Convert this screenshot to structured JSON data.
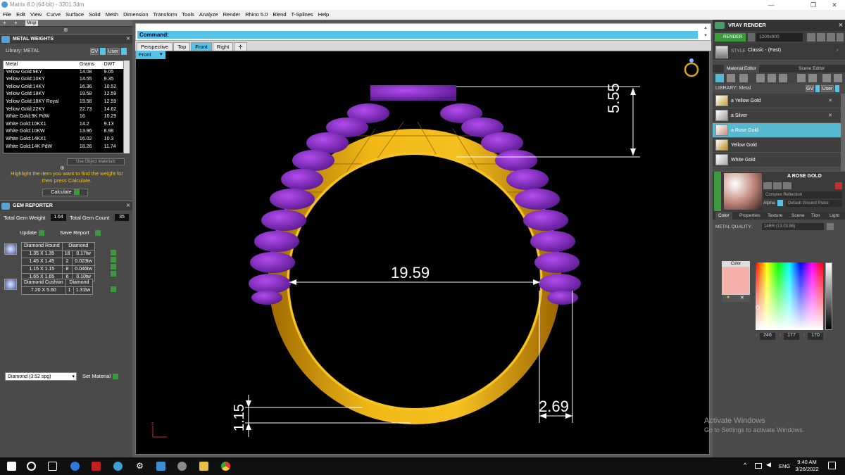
{
  "window": {
    "title": "Matrix 8.0 (64-bit) - 3201.3dm",
    "minimize": "—",
    "maximize": "❐",
    "close": "✕"
  },
  "menu": [
    "File",
    "Edit",
    "View",
    "Curve",
    "Surface",
    "Solid",
    "Mesh",
    "Dimension",
    "Transform",
    "Tools",
    "Analyze",
    "Render",
    "Rhino 5.0",
    "Blend",
    "T-Splines",
    "Help"
  ],
  "left_toolstrip": {
    "mngr": "Mngr"
  },
  "metal_weights": {
    "title": "METAL WEIGHTS",
    "library_label": "Library: METAL",
    "library_gv": "GV",
    "library_user": "User",
    "columns": [
      "Metal",
      "Grams",
      "DWT"
    ],
    "rows": [
      [
        "Yellow Gold:9KY",
        "14.08",
        "9.05"
      ],
      [
        "Yellow Gold:10KY",
        "14.55",
        "9.35"
      ],
      [
        "Yellow Gold:14KY",
        "16.36",
        "10.52"
      ],
      [
        "Yellow Gold:18KY",
        "19.58",
        "12.59"
      ],
      [
        "Yellow Gold:18KY Royal",
        "19.58",
        "12.59"
      ],
      [
        "Yellow Gold:22KY",
        "22.73",
        "14.62"
      ],
      [
        "White Gold:9K PdW",
        "16",
        "10.29"
      ],
      [
        "White Gold:10KX1",
        "14.2",
        "9.13"
      ],
      [
        "White Gold:10KW",
        "13.96",
        "8.98"
      ],
      [
        "White Gold:14KX1",
        "16.02",
        "10.3"
      ],
      [
        "White Gold:14K PdW",
        "18.26",
        "11.74"
      ]
    ],
    "use_object_materials": "Use Object Materials",
    "hint": "Highlight the item you want to find the weight for then press Calculate.",
    "calculate": "Calculate"
  },
  "gem_reporter": {
    "title": "GEM REPORTER",
    "total_weight_label": "Total Gem Weight",
    "total_weight": "1.64",
    "total_count_label": "Total Gem Count",
    "total_count": "35",
    "update": "Update",
    "save_report": "Save Report",
    "groups": [
      {
        "shape": "Diamond Round",
        "material": "Diamond",
        "rows": [
          [
            "1.35 X 1.35",
            "18",
            "0.17tw"
          ],
          [
            "1.45 X 1.45",
            "2",
            "0.023tw"
          ],
          [
            "1.15 X 1.15",
            "8",
            "0.046tw"
          ],
          [
            "1.65 X 1.65",
            "6",
            "0.10tw"
          ]
        ]
      },
      {
        "shape": "Diamond Cushion",
        "material": "Diamond",
        "rows": [
          [
            "7.20 X 5.60",
            "1",
            "1.31tw"
          ]
        ]
      }
    ],
    "material_select": "Diamond    (3.52 spg)",
    "set_material": "Set Material"
  },
  "command": {
    "label": "Command:"
  },
  "viewport_tabs": [
    "Perspective",
    "Top",
    "Front",
    "Right"
  ],
  "active_tab": "Front",
  "add_tab": "✛",
  "viewport_label": "Front",
  "dimensions": {
    "height": "5.55",
    "inner_diameter": "19.59",
    "shank_width": "2.69",
    "thickness": "1.15"
  },
  "axis": {
    "z": "z"
  },
  "vray": {
    "title": "VRAY RENDER",
    "render": "RENDER",
    "resolution": "1200x900",
    "style_label": "STYLE",
    "style": "Classic - (Fast)",
    "tabs": [
      "Material Editor",
      "Scene Editor"
    ],
    "library_label": "LIBRARY: Metal",
    "library_gv": "GV",
    "library_user": "User",
    "materials": [
      "a Yellow Gold",
      "a Silver",
      "a Rose Gold",
      "Yellow Gold",
      "White Gold"
    ],
    "selected_material": "a Rose Gold",
    "preview_title": "A ROSE GOLD",
    "complex_reflection": "Complex Reflection",
    "alpha": "Alpha",
    "ground_plane": "Default Ground Plane",
    "bottom_tabs": [
      "Color",
      "Properties",
      "Texture",
      "Scene",
      "Tion",
      "Light"
    ],
    "metal_quality_label": "METAL QUALITY:",
    "metal_quality": "14RR          (13.03.98)",
    "color_label": "Color",
    "color_hex": "#f6b1aa",
    "rgb": [
      "246",
      "177",
      "170"
    ]
  },
  "watermark": {
    "title": "Activate Windows",
    "subtitle": "Go to Settings to activate Windows."
  },
  "taskbar": {
    "time": "9:40 AM",
    "date": "3/26/2022",
    "lang": "ENG"
  }
}
